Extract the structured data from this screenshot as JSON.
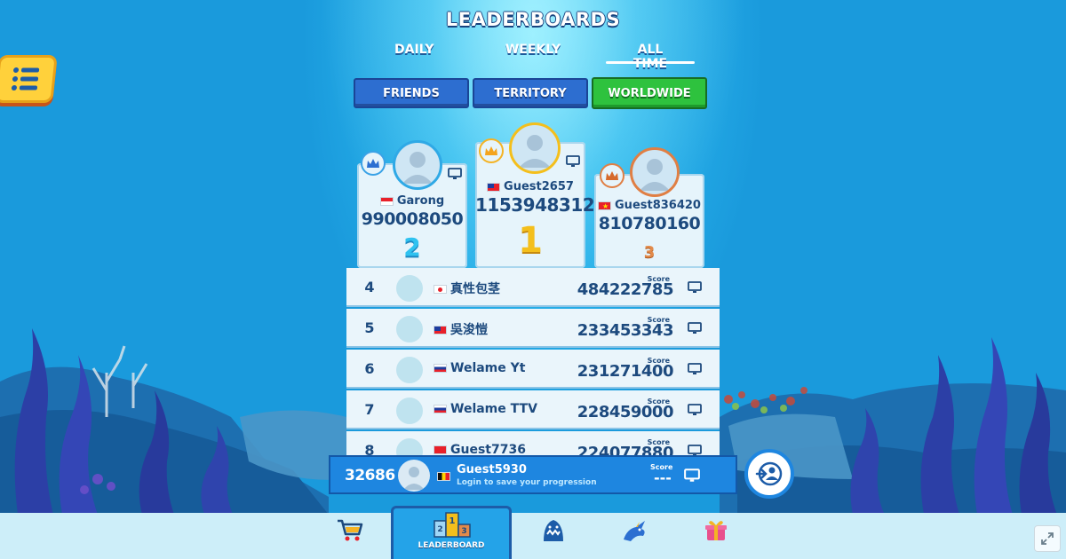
{
  "title": "LEADERBOARDS",
  "period_tabs": [
    {
      "label": "DAILY",
      "active": false
    },
    {
      "label": "WEEKLY",
      "active": false
    },
    {
      "label": "ALL TIME",
      "active": true
    }
  ],
  "scope_tabs": [
    {
      "label": "FRIENDS",
      "active": false
    },
    {
      "label": "TERRITORY",
      "active": false
    },
    {
      "label": "WORLDWIDE",
      "active": true
    }
  ],
  "podium": [
    {
      "rank": "2",
      "name": "Garong",
      "score": "990008050",
      "country": "Indonesia",
      "rank_color": "#2fc2f0",
      "crown_color": "#3aa2e6"
    },
    {
      "rank": "1",
      "name": "Guest2657",
      "score": "1153948312",
      "country": "Taiwan",
      "rank_color": "#f4bf1c",
      "crown_color": "#f4b324"
    },
    {
      "rank": "3",
      "name": "Guest836420",
      "score": "810780160",
      "country": "Vietnam",
      "rank_color": "#e28a4a",
      "crown_color": "#e07f44"
    }
  ],
  "rows": [
    {
      "rank": "4",
      "name": "真性包茎",
      "score": "484222785",
      "country": "Japan"
    },
    {
      "rank": "5",
      "name": "吳浚愷",
      "score": "233453343",
      "country": "Taiwan"
    },
    {
      "rank": "6",
      "name": "Welame Yt",
      "score": "231271400",
      "country": "Russia"
    },
    {
      "rank": "7",
      "name": "Welame TTV",
      "score": "228459000",
      "country": "Russia"
    },
    {
      "rank": "8",
      "name": "Guest7736",
      "score": "224077880",
      "country": "Unknown"
    }
  ],
  "score_label": "Score",
  "self": {
    "rank": "32686",
    "name": "Guest5930",
    "subtitle": "Login to save your progression",
    "score_label": "Score",
    "score": "---",
    "country": "Belgium"
  },
  "bottom_nav": {
    "active_label": "LEADERBOARD"
  },
  "colors": {
    "accent_blue": "#1e86e0",
    "worldwide_green": "#2ec23e",
    "text_dark": "#1d4a7e"
  }
}
